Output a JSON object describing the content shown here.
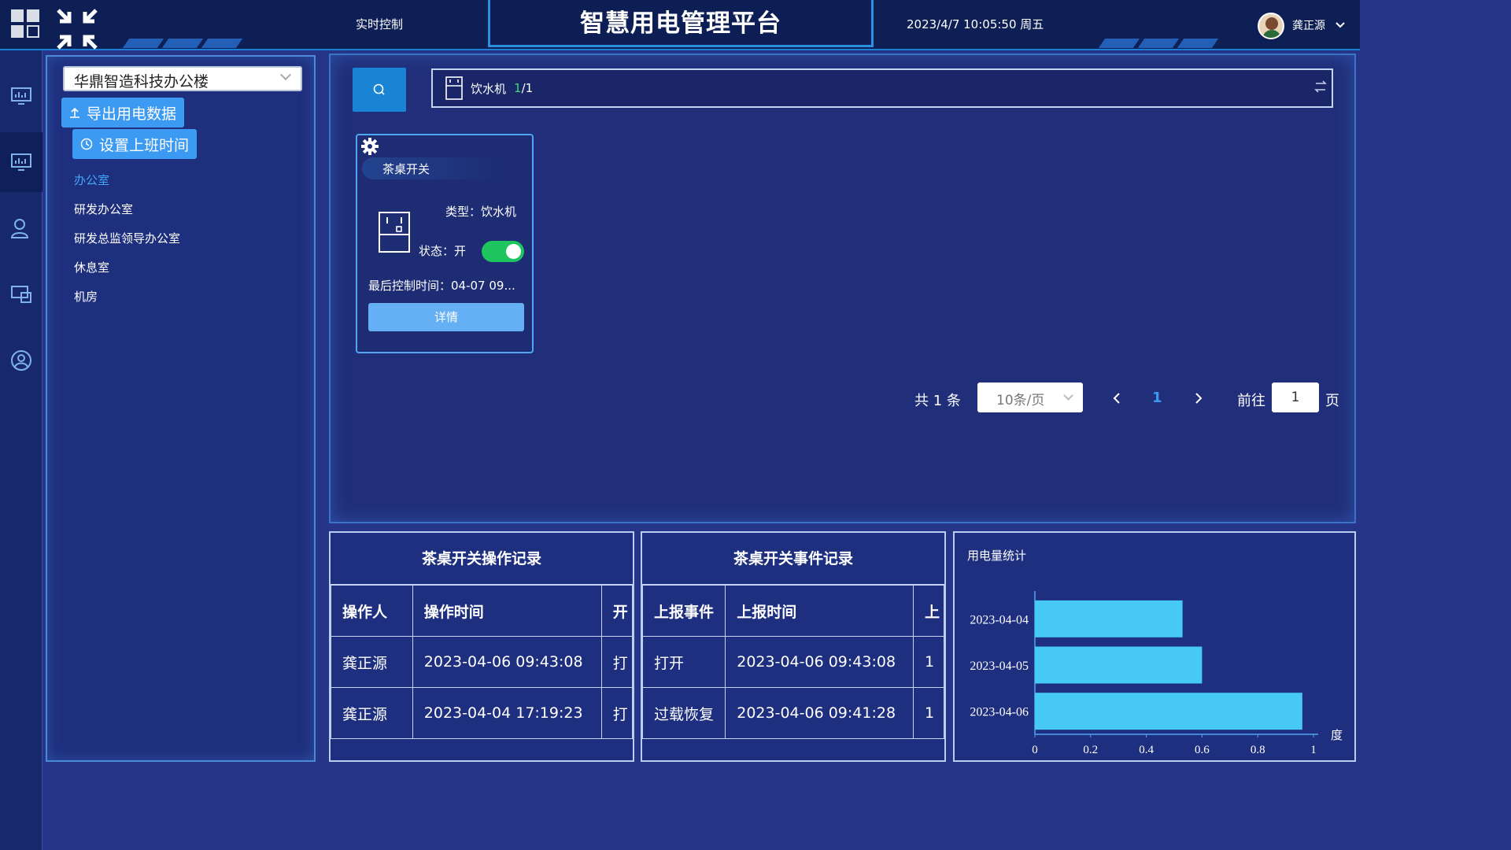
{
  "header": {
    "nav_label": "实时控制",
    "title": "智慧用电管理平台",
    "datetime": "2023/4/7 10:05:50 周五",
    "user_name": "龚正源"
  },
  "sidebar": {
    "building": "华鼎智造科技办公楼",
    "export_label": "导出用电数据",
    "worktime_label": "设置上班时间",
    "items": [
      {
        "label": "办公室",
        "active": true
      },
      {
        "label": "研发办公室"
      },
      {
        "label": "研发总监领导办公室"
      },
      {
        "label": "休息室"
      },
      {
        "label": "机房"
      }
    ]
  },
  "filter": {
    "device_type": "饮水机",
    "count_current": "1",
    "count_total": "/1"
  },
  "device_card": {
    "name": "茶桌开关",
    "type_text": "类型：饮水机",
    "status_text": "状态：开",
    "last_control": "最后控制时间：04-07 09...",
    "detail_label": "详情",
    "status_on": true
  },
  "pagination": {
    "total": "共 1 条",
    "page_size": "10条/页",
    "current_page": "1",
    "goto_label": "前往",
    "goto_value": "1",
    "page_unit": "页"
  },
  "op_log": {
    "title": "茶桌开关操作记录",
    "headers": [
      "操作人",
      "操作时间",
      "开"
    ],
    "rows": [
      [
        "龚正源",
        "2023-04-06 09:43:08",
        "打"
      ],
      [
        "龚正源",
        "2023-04-04 17:19:23",
        "打"
      ]
    ]
  },
  "event_log": {
    "title": "茶桌开关事件记录",
    "headers": [
      "上报事件",
      "上报时间",
      "上"
    ],
    "rows": [
      [
        "打开",
        "2023-04-06 09:43:08",
        "1"
      ],
      [
        "过载恢复",
        "2023-04-06 09:41:28",
        "1"
      ]
    ]
  },
  "colors": {
    "accent": "#3d9af2",
    "bar": "#46c9f4",
    "toggle_on": "#1ec45e"
  },
  "chart_data": {
    "type": "bar",
    "orientation": "horizontal",
    "title": "用电量统计",
    "categories": [
      "2023-04-04",
      "2023-04-05",
      "2023-04-06"
    ],
    "values": [
      0.53,
      0.6,
      0.96
    ],
    "xlim": [
      0,
      1
    ],
    "xticks": [
      "0",
      "0.2",
      "0.4",
      "0.6",
      "0.8",
      "1"
    ],
    "xunit": "度"
  }
}
